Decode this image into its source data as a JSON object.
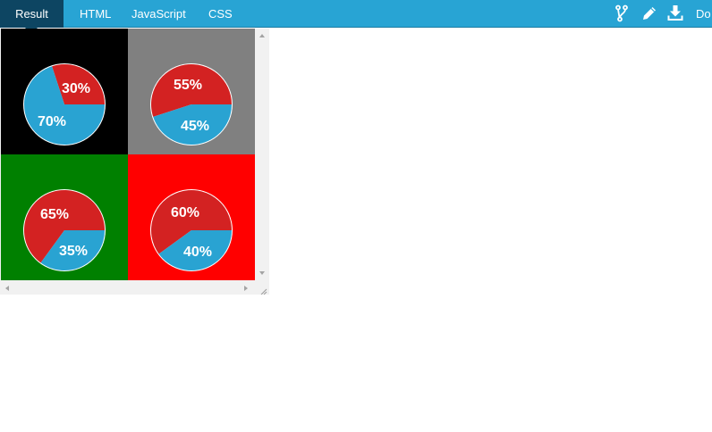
{
  "tabs": [
    {
      "label": "Result",
      "active": true
    },
    {
      "label": "HTML",
      "active": false
    },
    {
      "label": "JavaScript",
      "active": false
    },
    {
      "label": "CSS",
      "active": false
    }
  ],
  "toolbar": {
    "fork_icon": "fork-icon",
    "edit_icon": "pencil-icon",
    "download_icon": "download-icon",
    "download_label": "Do"
  },
  "colors": {
    "topbar": "#28a4d4",
    "active_tab": "#0d4562",
    "slice_red": "#d32222",
    "slice_blue": "#29a3d2"
  },
  "chart_data": [
    {
      "type": "pie",
      "background": "#000000",
      "slices": [
        {
          "label": "30%",
          "value": 30,
          "color": "#d32222"
        },
        {
          "label": "70%",
          "value": 70,
          "color": "#29a3d2"
        }
      ]
    },
    {
      "type": "pie",
      "background": "#808080",
      "slices": [
        {
          "label": "55%",
          "value": 55,
          "color": "#d32222"
        },
        {
          "label": "45%",
          "value": 45,
          "color": "#29a3d2"
        }
      ]
    },
    {
      "type": "pie",
      "background": "#008000",
      "slices": [
        {
          "label": "65%",
          "value": 65,
          "color": "#d32222"
        },
        {
          "label": "35%",
          "value": 35,
          "color": "#29a3d2"
        }
      ]
    },
    {
      "type": "pie",
      "background": "#ff0000",
      "slices": [
        {
          "label": "60%",
          "value": 60,
          "color": "#d32222"
        },
        {
          "label": "40%",
          "value": 40,
          "color": "#29a3d2"
        }
      ]
    }
  ]
}
